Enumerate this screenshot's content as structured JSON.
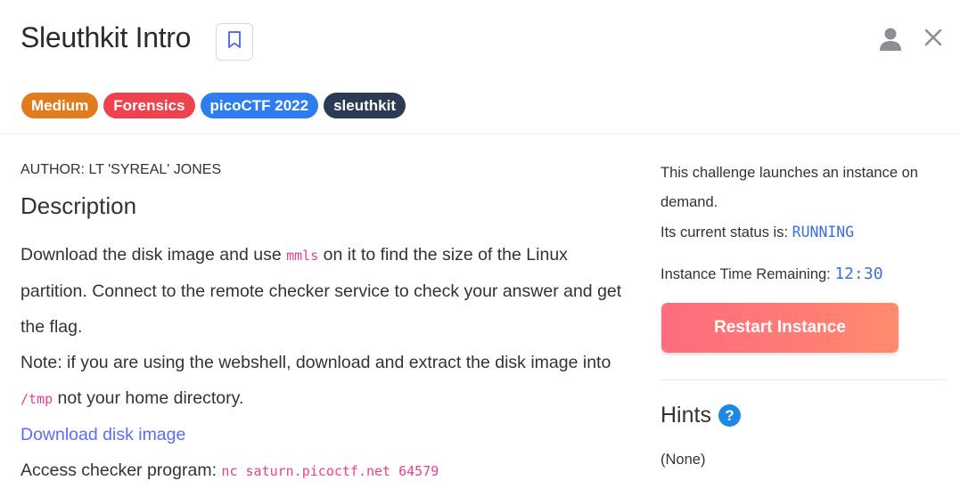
{
  "header": {
    "title": "Sleuthkit Intro",
    "icons": {
      "bookmark": "bookmark-icon",
      "user": "user-icon",
      "close": "close-icon"
    }
  },
  "tags": [
    {
      "label": "Medium",
      "color": "#e07b1f"
    },
    {
      "label": "Forensics",
      "color": "#f0414e"
    },
    {
      "label": "picoCTF 2022",
      "color": "#2f7cf2"
    },
    {
      "label": "sleuthkit",
      "color": "#2d3a55"
    }
  ],
  "main": {
    "author": "AUTHOR: LT 'SYREAL' JONES",
    "description_heading": "Description",
    "description": {
      "part1": "Download the disk image and use ",
      "code1": "mmls",
      "part2": " on it to find the size of the Linux partition. Connect to the remote checker service to check your answer and get the flag.",
      "note1": "Note: if you are using the webshell, download and extract the disk image into ",
      "code2": "/tmp",
      "note2": " not your home directory.",
      "download_link": "Download disk image",
      "access_label": "Access checker program: ",
      "access_cmd": "nc saturn.picoctf.net 64579"
    }
  },
  "sidebar": {
    "instance_text": "This challenge launches an instance on demand.",
    "status_label": "Its current status is: ",
    "status_value": "RUNNING",
    "time_label": "Instance Time Remaining: ",
    "time_value": "12:30",
    "restart_button": "Restart Instance",
    "hints_heading": "Hints",
    "hints_value": "(None)"
  },
  "colors": {
    "accent": "#5b6cf5",
    "code": "#e83e8c",
    "status": "#3b6fe0",
    "button_gradient": [
      "#ff6b7f",
      "#ff8c6e"
    ],
    "help_icon": "#1e88e5"
  }
}
